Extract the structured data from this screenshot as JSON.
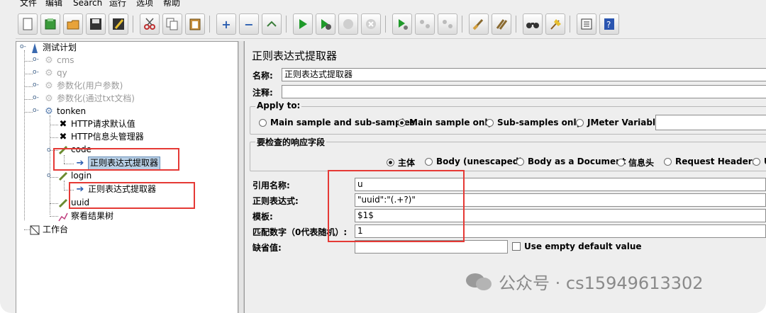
{
  "menu": [
    "文件",
    "编辑",
    "Search",
    "运行",
    "选项",
    "帮助"
  ],
  "toolbar_icons": [
    "new-icon",
    "templates-icon",
    "open-icon",
    "save-icon",
    "save-as-icon",
    "cut-icon",
    "copy-icon",
    "paste-icon",
    "expand-icon",
    "collapse-icon",
    "toggle-icon",
    "start-icon",
    "start-no-pause-icon",
    "stop-icon",
    "shutdown-icon",
    "remote-start-icon",
    "remote-stop-icon",
    "remote-shutdown-icon",
    "clear-icon",
    "clear-all-icon",
    "search-icon",
    "reset-search-icon",
    "function-helper-icon",
    "help-icon"
  ],
  "tree": {
    "root": "测试计划",
    "items": [
      {
        "label": "cms"
      },
      {
        "label": "qy"
      },
      {
        "label": "参数化(用户参数)"
      },
      {
        "label": "参数化(通过txt文档)"
      },
      {
        "label": "tonken"
      },
      {
        "label": "HTTP请求默认值"
      },
      {
        "label": "HTTP信息头管理器"
      },
      {
        "label": "code"
      },
      {
        "label": "正则表达式提取器"
      },
      {
        "label": "login"
      },
      {
        "label": "正则表达式提取器"
      },
      {
        "label": "uuid"
      },
      {
        "label": "察看结果树"
      }
    ],
    "workbench": "工作台"
  },
  "panel": {
    "title": "正则表达式提取器",
    "name_label": "名称:",
    "name_value": "正则表达式提取器",
    "comment_label": "注释:",
    "comment_value": "",
    "apply_to": {
      "title": "Apply to:",
      "options": [
        "Main sample and sub-samples",
        "Main sample only",
        "Sub-samples only",
        "JMeter Variable"
      ],
      "selected": "Main sample only"
    },
    "response_field": {
      "title": "要检查的响应字段",
      "options": [
        "主体",
        "Body (unescaped)",
        "Body as a Document",
        "信息头",
        "Request Headers",
        "U"
      ],
      "selected": "主体"
    },
    "ref_name_label": "引用名称:",
    "ref_name_value": "u",
    "regex_label": "正则表达式:",
    "regex_value": "\"uuid\":\"(.+?)\"",
    "template_label": "模板:",
    "template_value": "$1$",
    "match_no_label": "匹配数字（0代表随机）:",
    "match_no_value": "1",
    "default_label": "缺省值:",
    "default_value": "",
    "use_empty_default": "Use empty default value"
  },
  "watermark": "公众号 · cs15949613302",
  "colors": {
    "highlight_box": "#e53935",
    "selection": "#b8cfe5",
    "panel_bg": "#eeeeee"
  }
}
